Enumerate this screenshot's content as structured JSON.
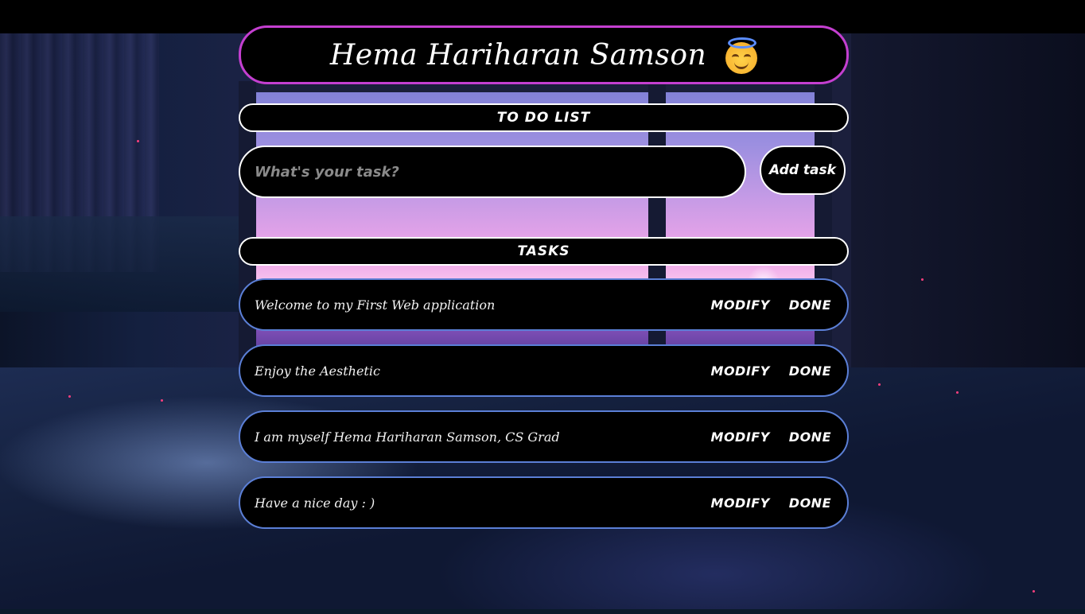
{
  "header": {
    "title": "Hema Hariharan Samson",
    "emoji_icon": "smiling-face-with-halo-icon"
  },
  "todo_section": {
    "label": "TO DO LIST",
    "input_placeholder": "What's your task?",
    "input_value": "",
    "add_button_label": "Add task"
  },
  "tasks_section": {
    "label": "TASKS",
    "items": [
      {
        "text": "Welcome to my First Web application",
        "modify_label": "MODIFY",
        "done_label": "DONE"
      },
      {
        "text": "Enjoy the Aesthetic",
        "modify_label": "MODIFY",
        "done_label": "DONE"
      },
      {
        "text": "I am myself Hema Hariharan Samson, CS Grad",
        "modify_label": "MODIFY",
        "done_label": "DONE"
      },
      {
        "text": "Have a nice day : )",
        "modify_label": "MODIFY",
        "done_label": "DONE"
      }
    ]
  },
  "colors": {
    "title_border": "#c43fd0",
    "task_border": "#5b7fd6",
    "panel_background": "#000000",
    "text": "#ffffff"
  }
}
